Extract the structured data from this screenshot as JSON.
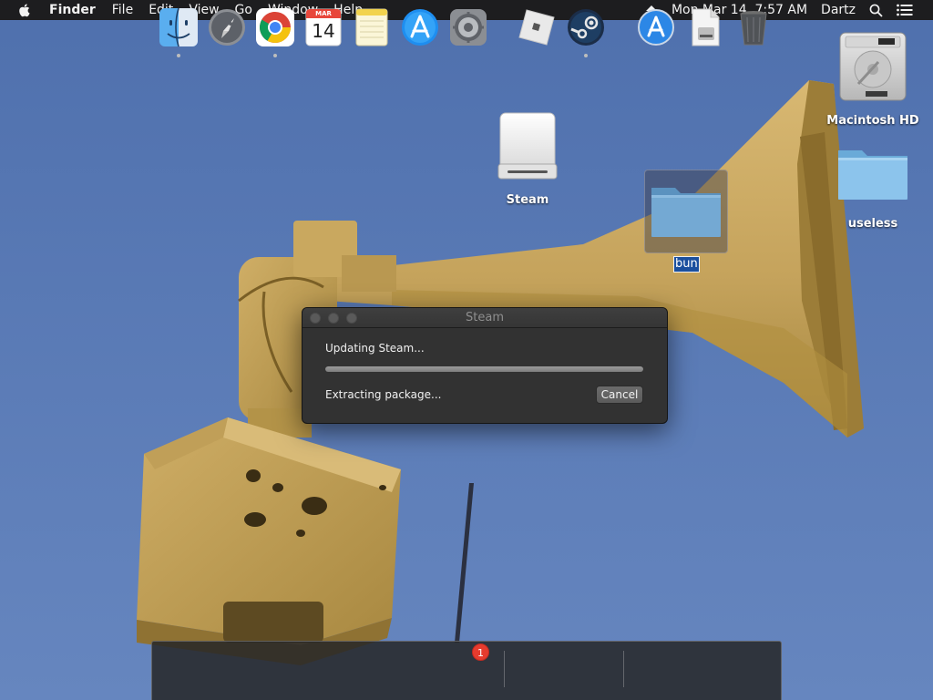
{
  "menubar": {
    "app_name": "Finder",
    "menus": [
      "File",
      "Edit",
      "View",
      "Go",
      "Window",
      "Help"
    ],
    "clock": "Mon Mar 14  7:57 AM",
    "user": "Dartz"
  },
  "desktop": {
    "icons": {
      "steam_drive": "Steam",
      "macintosh_hd": "Macintosh HD",
      "useless": "useless",
      "bun": "bun"
    }
  },
  "dialog": {
    "title": "Steam",
    "status": "Updating Steam...",
    "substatus": "Extracting package...",
    "cancel_label": "Cancel",
    "progress": 1.0
  },
  "dock": {
    "apps": [
      "finder-icon",
      "launchpad-icon",
      "chrome-icon",
      "calendar-icon",
      "notes-icon",
      "app-store-icon",
      "system-preferences-icon",
      "roblox-icon",
      "steam-icon",
      "applications-folder-icon",
      "disk-image-icon",
      "trash-icon"
    ],
    "calendar": {
      "month": "MAR",
      "day": "14"
    },
    "system_prefs_badge": "1"
  },
  "colors": {
    "sky": "#5b7bb4",
    "siren": "#c7a75f",
    "menubar": "#1d1d1f",
    "dialog_bg": "#323232",
    "badge": "#e63b2e"
  }
}
